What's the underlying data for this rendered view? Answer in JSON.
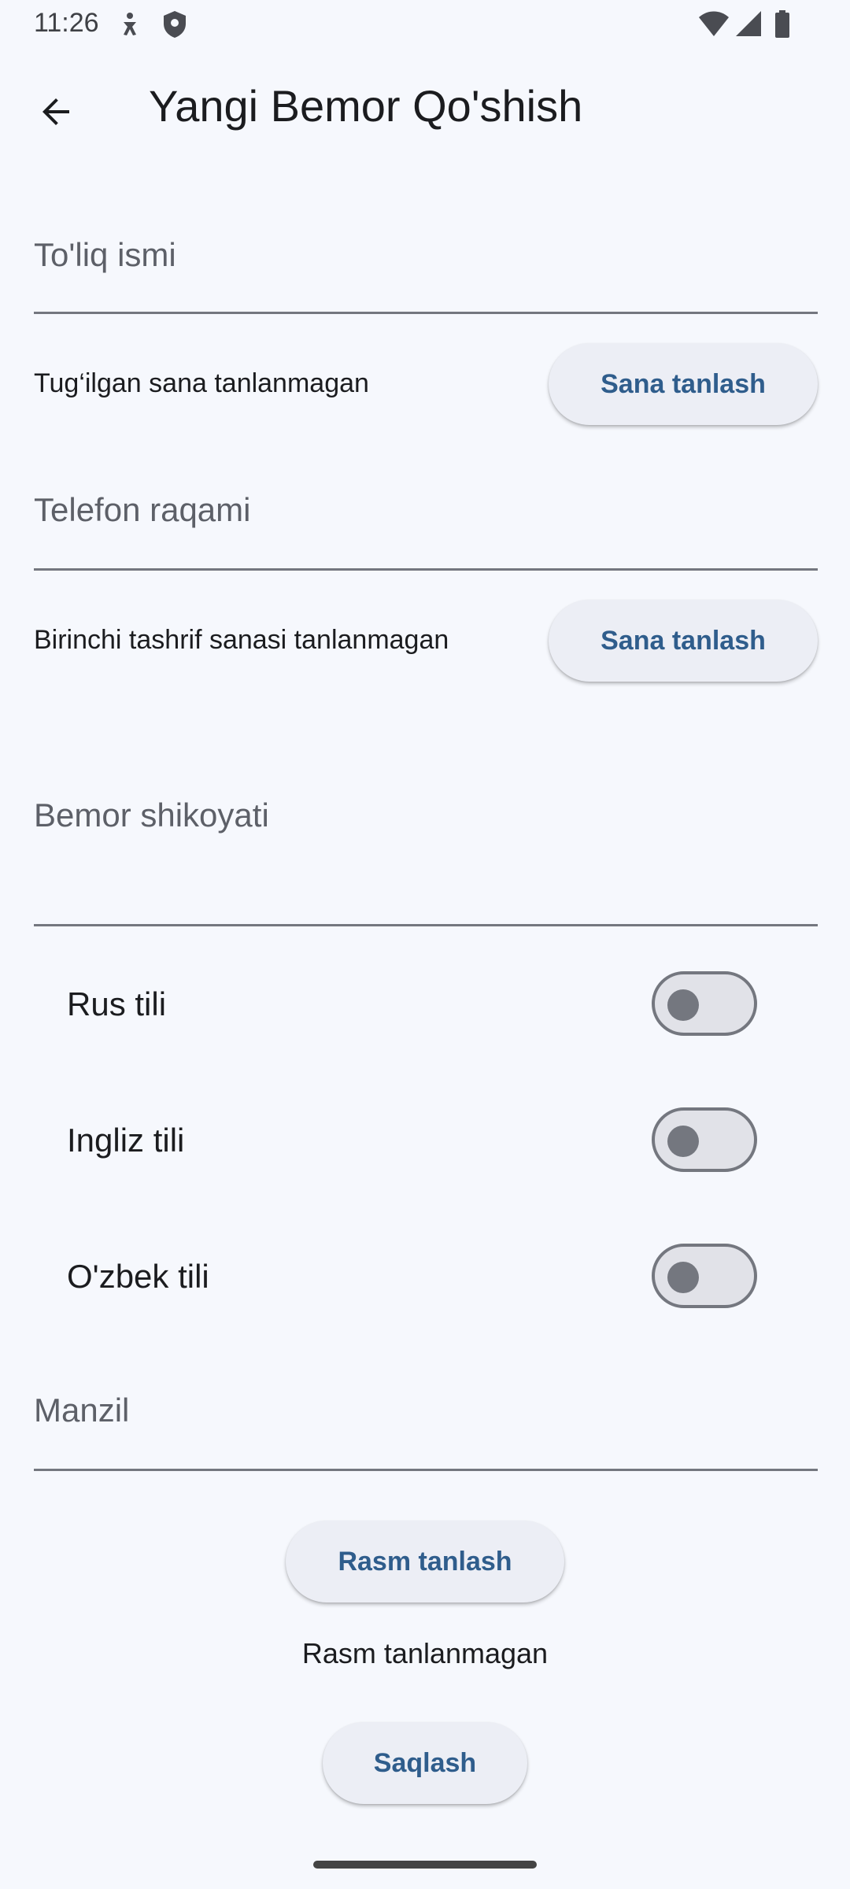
{
  "status_bar": {
    "time": "11:26"
  },
  "app_bar": {
    "back_icon": "arrow-back-icon",
    "title": "Yangi Bemor Qo'shish"
  },
  "form": {
    "full_name_label": "To'liq ismi",
    "birth_date_text": "Tug‘ilgan sana tanlanmagan",
    "birth_date_button": "Sana tanlash",
    "phone_label": "Telefon raqami",
    "first_visit_text": "Birinchi tashrif sanasi tanlanmagan",
    "first_visit_button": "Sana tanlash",
    "complaint_label": "Bemor shikoyati",
    "languages": [
      {
        "label": "Rus tili",
        "enabled": false
      },
      {
        "label": "Ingliz tili",
        "enabled": false
      },
      {
        "label": "O'zbek tili",
        "enabled": false
      }
    ],
    "address_label": "Manzil",
    "image_button": "Rasm tanlash",
    "image_status": "Rasm tanlanmagan",
    "save_button": "Saqlash"
  },
  "colors": {
    "background": "#f6f8fd",
    "button_text": "#2f5d8c",
    "button_bg": "#eceef5",
    "outline": "#74777f"
  }
}
